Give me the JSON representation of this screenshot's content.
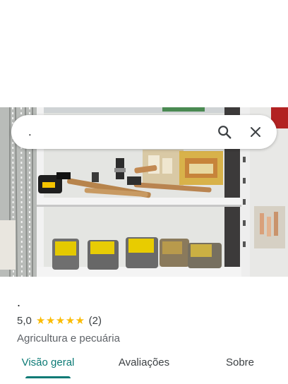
{
  "search": {
    "value": ".",
    "search_icon": "search-icon",
    "clear_icon": "close-icon"
  },
  "photo": {
    "description_icon": "store-shelf-photo"
  },
  "place": {
    "title": ".",
    "rating": "5,0",
    "stars": 5,
    "review_count": "(2)",
    "category": "Agricultura e pecuária"
  },
  "tabs": [
    {
      "label": "Visão geral",
      "active": true
    },
    {
      "label": "Avaliações",
      "active": false
    },
    {
      "label": "Sobre",
      "active": false
    }
  ],
  "colors": {
    "accent": "#0b7a75",
    "star": "#fbbc04"
  }
}
